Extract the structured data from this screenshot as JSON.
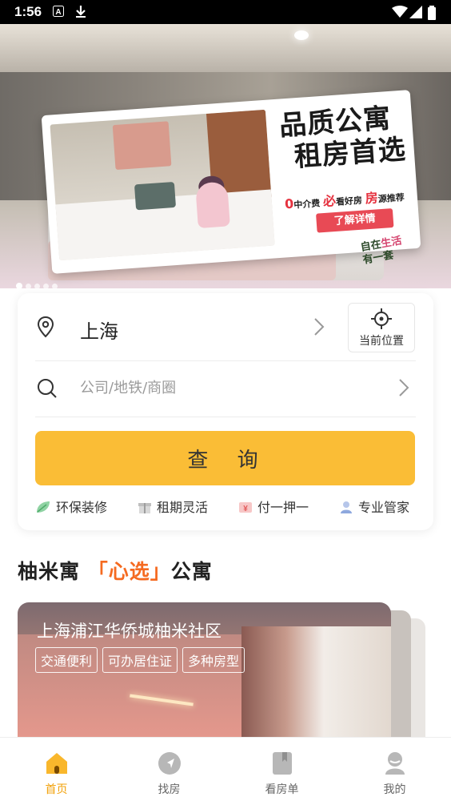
{
  "status_bar": {
    "time": "1:56"
  },
  "banner": {
    "title_line1": "品质公寓",
    "title_line2": "租房首选",
    "promo_zero": "0",
    "promo_fee": "中介费",
    "promo_must": "必",
    "promo_good": "看好房",
    "promo_fang": "房",
    "promo_recommend": "源推荐",
    "cta": "了解详情",
    "slogan_1": "自在",
    "slogan_2": "生活",
    "slogan_3": "有一套",
    "dots": 5,
    "active_dot": 0
  },
  "search": {
    "city": "上海",
    "locate_label": "当前位置",
    "placeholder": "公司/地铁/商圈",
    "query_button": "查 询",
    "features": [
      {
        "icon": "leaf-icon",
        "label": "环保装修"
      },
      {
        "icon": "gift-icon",
        "label": "租期灵活"
      },
      {
        "icon": "money-icon",
        "label": "付一押一"
      },
      {
        "icon": "person-icon",
        "label": "专业管家"
      }
    ]
  },
  "section": {
    "prefix": "柚米寓",
    "quote_open": "「",
    "highlight": "心选",
    "quote_close": "」",
    "suffix": "公寓"
  },
  "apartment": {
    "title": "上海浦江华侨城柚米社区",
    "tags": [
      "交通便利",
      "可办居住证",
      "多种房型"
    ]
  },
  "bottom_nav": [
    {
      "icon": "home-icon",
      "label": "首页",
      "active": true
    },
    {
      "icon": "navigate-icon",
      "label": "找房",
      "active": false
    },
    {
      "icon": "bookmark-icon",
      "label": "看房单",
      "active": false
    },
    {
      "icon": "profile-icon",
      "label": "我的",
      "active": false
    }
  ],
  "colors": {
    "accent": "#fabd36",
    "nav_active": "#f2a10a",
    "highlight": "#f56a20",
    "promo_red": "#e84a55"
  }
}
